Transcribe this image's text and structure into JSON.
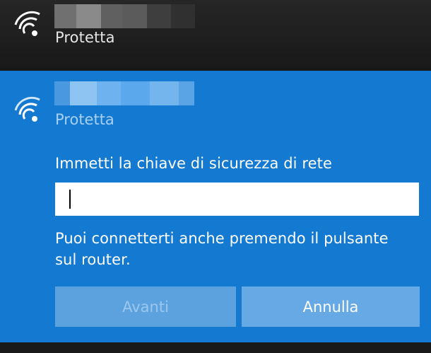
{
  "networks": {
    "top": {
      "status": "Protetta"
    },
    "selected": {
      "status": "Protetta",
      "key_label": "Immetti la chiave di sicurezza di rete",
      "key_value": "",
      "router_hint": "Puoi connetterti anche premendo il pulsante sul router.",
      "buttons": {
        "next": "Avanti",
        "cancel": "Annulla"
      }
    }
  },
  "icons": {
    "top_wifi": "wifi-signal-icon",
    "selected_wifi": "wifi-signal-icon"
  },
  "colors": {
    "panel": "#1479d1",
    "top_background": "#1e1e1e",
    "disabled_button": "#5ca2df",
    "cancel_button": "#67a9e5"
  }
}
